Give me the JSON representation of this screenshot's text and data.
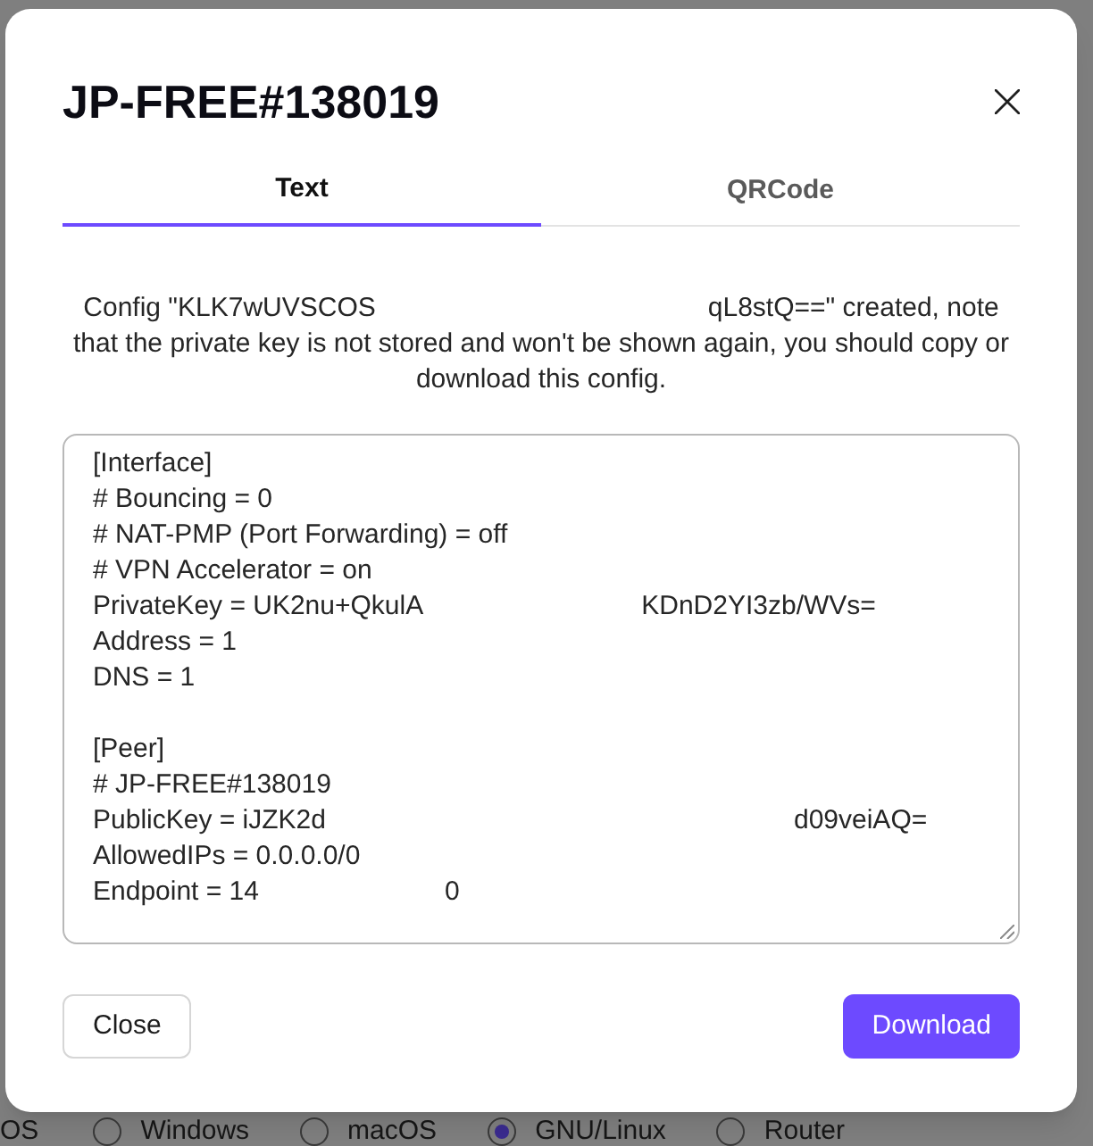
{
  "dialog": {
    "title": "JP-FREE#138019",
    "tabs": [
      {
        "label": "Text",
        "selected": true
      },
      {
        "label": "QRCode",
        "selected": false
      }
    ],
    "message": [
      "Config \"KLK7wUVSCOS",
      "qL8stQ==\" created, note that the private key is not stored and won't be shown again, you should copy or download this config."
    ],
    "config": {
      "sections": [
        {
          "lines": [
            [
              "[Interface]"
            ],
            [
              "# Bouncing = 0"
            ],
            [
              "# NAT-PMP (Port Forwarding) = off"
            ],
            [
              "# VPN Accelerator = on"
            ],
            [
              "PrivateKey = UK2nu+QkulA",
              "KDnD2YI3zb/WVs="
            ],
            [
              "Address = 1"
            ],
            [
              "DNS = 1"
            ]
          ]
        },
        {
          "lines": [
            [
              "[Peer]"
            ],
            [
              "# JP-FREE#138019"
            ],
            [
              "PublicKey = iJZK2d",
              "d09veiAQ="
            ],
            [
              "AllowedIPs = 0.0.0.0/0"
            ],
            [
              "Endpoint = 14",
              "0"
            ]
          ]
        }
      ]
    },
    "buttons": [
      {
        "label": "Close",
        "kind": "secondary"
      },
      {
        "label": "Download",
        "kind": "primary"
      }
    ]
  },
  "background": {
    "os_label": "OS",
    "os_options": [
      {
        "label": "Windows",
        "selected": false
      },
      {
        "label": "macOS",
        "selected": false
      },
      {
        "label": "GNU/Linux",
        "selected": true
      },
      {
        "label": "Router",
        "selected": false
      }
    ]
  }
}
